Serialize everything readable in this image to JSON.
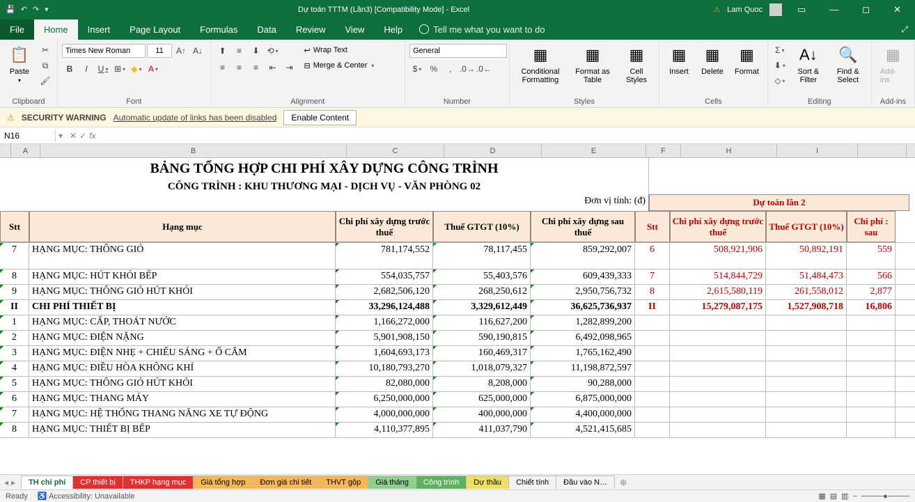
{
  "app": {
    "title": "Dự toán TTTM (Lần3)  [Compatibility Mode]  -  Excel",
    "user": "Lam Quoc"
  },
  "tabs": {
    "file": "File",
    "home": "Home",
    "insert": "Insert",
    "page_layout": "Page Layout",
    "formulas": "Formulas",
    "data": "Data",
    "review": "Review",
    "view": "View",
    "help": "Help",
    "tell_me": "Tell me what you want to do"
  },
  "ribbon": {
    "clipboard": {
      "label": "Clipboard",
      "paste": "Paste"
    },
    "font": {
      "label": "Font",
      "name": "Times New Roman",
      "size": "11"
    },
    "alignment": {
      "label": "Alignment",
      "wrap": "Wrap Text",
      "merge": "Merge & Center"
    },
    "number": {
      "label": "Number",
      "format": "General"
    },
    "styles": {
      "label": "Styles",
      "cond": "Conditional Formatting",
      "table": "Format as Table",
      "cell": "Cell Styles"
    },
    "cells": {
      "label": "Cells",
      "insert": "Insert",
      "delete": "Delete",
      "format": "Format"
    },
    "editing": {
      "label": "Editing",
      "sort": "Sort & Filter",
      "find": "Find & Select"
    },
    "addins": {
      "label": "Add-ins",
      "btn": "Add-ins"
    }
  },
  "security": {
    "label": "SECURITY WARNING",
    "msg": "Automatic update of links has been disabled",
    "btn": "Enable Content"
  },
  "namebox": "N16",
  "sheet": {
    "title1": "BẢNG TỔNG HỢP CHI PHÍ XÂY DỰNG CÔNG TRÌNH",
    "title2": "CÔNG TRÌNH : KHU THƯƠNG MẠI - DỊCH VỤ - VĂN PHÒNG 02",
    "unit": "Đơn vị tính:  (đ)",
    "dutoan2": "Dự toán lần 2",
    "headers": {
      "stt": "Stt",
      "hangmuc": "Hạng mục",
      "cp_truoc": "Chi phí xây dựng trước thuế",
      "thue": "Thuế GTGT (10%)",
      "cp_sau": "Chi phí xây dựng sau thuế",
      "stt2": "Stt",
      "cp_truoc2": "Chi phí xây dựng trước thuế",
      "thue2": "Thuế GTGT (10%)",
      "cp_sau2": "Chi phí : sau"
    },
    "cols": [
      "A",
      "B",
      "C",
      "D",
      "E",
      "F",
      "H",
      "I"
    ],
    "rows": [
      {
        "stt": "7",
        "name": "HẠNG MỤC: THÔNG GIÓ",
        "c": "781,174,552",
        "d": "78,117,455",
        "e": "859,292,007",
        "f": "6",
        "h": "508,921,906",
        "i": "50,892,191",
        "j": "559"
      },
      {
        "stt": "8",
        "name": "HẠNG MỤC: HÚT KHÓI BẾP",
        "c": "554,035,757",
        "d": "55,403,576",
        "e": "609,439,333",
        "f": "7",
        "h": "514,844,729",
        "i": "51,484,473",
        "j": "566"
      },
      {
        "stt": "9",
        "name": "HẠNG MỤC: THÔNG GIÓ HÚT KHÓI",
        "c": "2,682,506,120",
        "d": "268,250,612",
        "e": "2,950,756,732",
        "f": "8",
        "h": "2,615,580,119",
        "i": "261,558,012",
        "j": "2,877"
      },
      {
        "stt": "II",
        "name": "CHI PHÍ THIẾT BỊ",
        "c": "33,296,124,488",
        "d": "3,329,612,449",
        "e": "36,625,736,937",
        "f": "II",
        "h": "15,279,087,175",
        "i": "1,527,908,718",
        "j": "16,806",
        "bold": true
      },
      {
        "stt": "1",
        "name": "HẠNG MỤC: CẤP, THOÁT NƯỚC",
        "c": "1,166,272,000",
        "d": "116,627,200",
        "e": "1,282,899,200",
        "f": "",
        "h": "",
        "i": "",
        "j": ""
      },
      {
        "stt": "2",
        "name": "HẠNG MỤC: ĐIỆN NẶNG",
        "c": "5,901,908,150",
        "d": "590,190,815",
        "e": "6,492,098,965",
        "f": "",
        "h": "",
        "i": "",
        "j": ""
      },
      {
        "stt": "3",
        "name": "HẠNG MỤC: ĐIỆN NHẸ + CHIẾU SÁNG + Ổ CẮM",
        "c": "1,604,693,173",
        "d": "160,469,317",
        "e": "1,765,162,490",
        "f": "",
        "h": "",
        "i": "",
        "j": ""
      },
      {
        "stt": "4",
        "name": "HẠNG MỤC: ĐIỀU HÒA KHÔNG KHÍ",
        "c": "10,180,793,270",
        "d": "1,018,079,327",
        "e": "11,198,872,597",
        "f": "",
        "h": "",
        "i": "",
        "j": ""
      },
      {
        "stt": "5",
        "name": "HẠNG MỤC: THÔNG GIÓ HÚT KHÓI",
        "c": "82,080,000",
        "d": "8,208,000",
        "e": "90,288,000",
        "f": "",
        "h": "",
        "i": "",
        "j": ""
      },
      {
        "stt": "6",
        "name": "HẠNG MỤC: THANG MÁY",
        "c": "6,250,000,000",
        "d": "625,000,000",
        "e": "6,875,000,000",
        "f": "",
        "h": "",
        "i": "",
        "j": ""
      },
      {
        "stt": "7",
        "name": "HẠNG MỤC: HỆ THỐNG THANG NÂNG XE TỰ ĐỘNG",
        "c": "4,000,000,000",
        "d": "400,000,000",
        "e": "4,400,000,000",
        "f": "",
        "h": "",
        "i": "",
        "j": ""
      },
      {
        "stt": "8",
        "name": "HẠNG MỤC: THIẾT BỊ BẾP",
        "c": "4,110,377,895",
        "d": "411,037,790",
        "e": "4,521,415,685",
        "f": "",
        "h": "",
        "i": "",
        "j": ""
      }
    ]
  },
  "sheet_tabs": [
    {
      "name": "TH chi phí",
      "cls": "active"
    },
    {
      "name": "CP thiết bị",
      "cls": "st-red"
    },
    {
      "name": "THKP hạng mục",
      "cls": "st-red"
    },
    {
      "name": "Giá tổng hợp",
      "cls": "st-orange"
    },
    {
      "name": "Đơn giá chi tiết",
      "cls": "st-orange"
    },
    {
      "name": "THVT gộp",
      "cls": "st-orange"
    },
    {
      "name": "Giá tháng",
      "cls": "st-green"
    },
    {
      "name": "Công trình",
      "cls": "st-darkgreen"
    },
    {
      "name": "Dự thầu",
      "cls": "st-yellow"
    },
    {
      "name": "Chiết tính",
      "cls": ""
    },
    {
      "name": "Đầu vào N…",
      "cls": ""
    }
  ],
  "status": {
    "ready": "Ready",
    "acc": "Accessibility: Unavailable"
  }
}
